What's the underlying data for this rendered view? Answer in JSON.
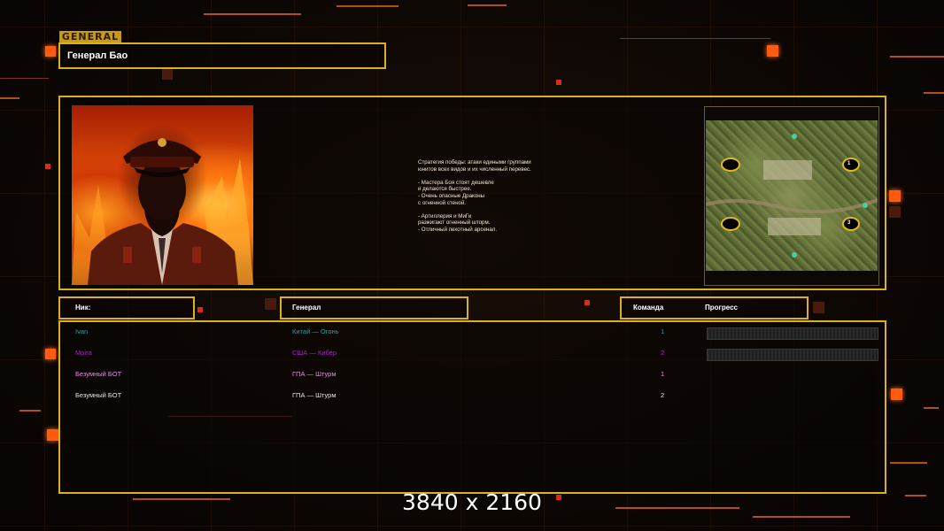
{
  "header": {
    "logo": "GENERAL",
    "title": "Генерал Бао"
  },
  "general": {
    "description": "Стратегия победы: атаки едиными группами\nюнитов всех видов и их численный перевес.\n\n- Мастера Боя стоят дешевле\nи делаются быстрее.\n- Очень опасные Драконы\nс огненной стеной.\n\n- Артиллерия и МиГи\nразжигают огненный шторм.\n- Отличный пехотный арсенал."
  },
  "columns": {
    "nick": "Ник:",
    "general": "Генерал",
    "team": "Команда",
    "progress": "Прогресс"
  },
  "players": [
    {
      "nick": "Ivan",
      "general": "Китай — Огонь",
      "team": "1",
      "color": "#1fa7a4",
      "show_progress": true
    },
    {
      "nick": "Moira",
      "general": "США — Кибер",
      "team": "2",
      "color": "#9b2bc4",
      "show_progress": true
    },
    {
      "nick": "Безумный БОТ",
      "general": "ГПА — Штурм",
      "team": "1",
      "color": "#e48fe6",
      "show_progress": false
    },
    {
      "nick": "Безумный БОТ",
      "general": "ГПА — Штурм",
      "team": "2",
      "color": "#e6e6e6",
      "show_progress": false
    }
  ],
  "minimap": {
    "player_slots": [
      "1",
      "3"
    ]
  },
  "footer": {
    "resolution": "3840 x 2160"
  },
  "colors": {
    "frame": "#d9b219",
    "accent": "#ff5a10"
  }
}
